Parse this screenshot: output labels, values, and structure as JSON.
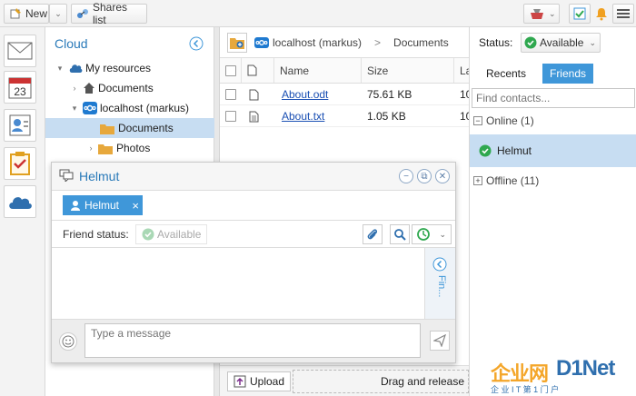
{
  "toolbar": {
    "new_label": "New",
    "shares_label": "Shares list"
  },
  "tree": {
    "title": "Cloud",
    "items": [
      {
        "label": "My resources"
      },
      {
        "label": "Documents"
      },
      {
        "label": "localhost (markus)"
      },
      {
        "label": "Documents"
      },
      {
        "label": "Photos"
      }
    ]
  },
  "files": {
    "breadcrumb": {
      "server": "localhost (markus)",
      "separator": ">",
      "folder": "Documents"
    },
    "columns": {
      "name": "Name",
      "size": "Size",
      "last": "La"
    },
    "rows": [
      {
        "name": "About.odt",
        "size": "75.61 KB",
        "date": "10"
      },
      {
        "name": "About.txt",
        "size": "1.05 KB",
        "date": "10"
      }
    ],
    "upload_label": "Upload",
    "drag_label": "Drag and release"
  },
  "right": {
    "status_label": "Status:",
    "status_value": "Available",
    "tabs": [
      {
        "label": "Recents"
      },
      {
        "label": "Friends"
      }
    ],
    "find_placeholder": "Find contacts...",
    "online_group": "Online (1)",
    "online_contact": "Helmut",
    "offline_group": "Offline (11)"
  },
  "chat": {
    "title": "Helmut",
    "tab_label": "Helmut",
    "tab_close": "×",
    "friend_status_label": "Friend status:",
    "friend_status_value": "Available",
    "side_text": "Fin...",
    "message_placeholder": "Type a message"
  },
  "watermark": {
    "brand_cn": "企业网",
    "brand_en": "D1Net",
    "sub": "企 业 I T 第 1 门 户"
  },
  "colors": {
    "accent": "#3f97d9",
    "selection": "#c7ddf2",
    "link": "#1a4fb3",
    "online": "#2fa84f"
  }
}
